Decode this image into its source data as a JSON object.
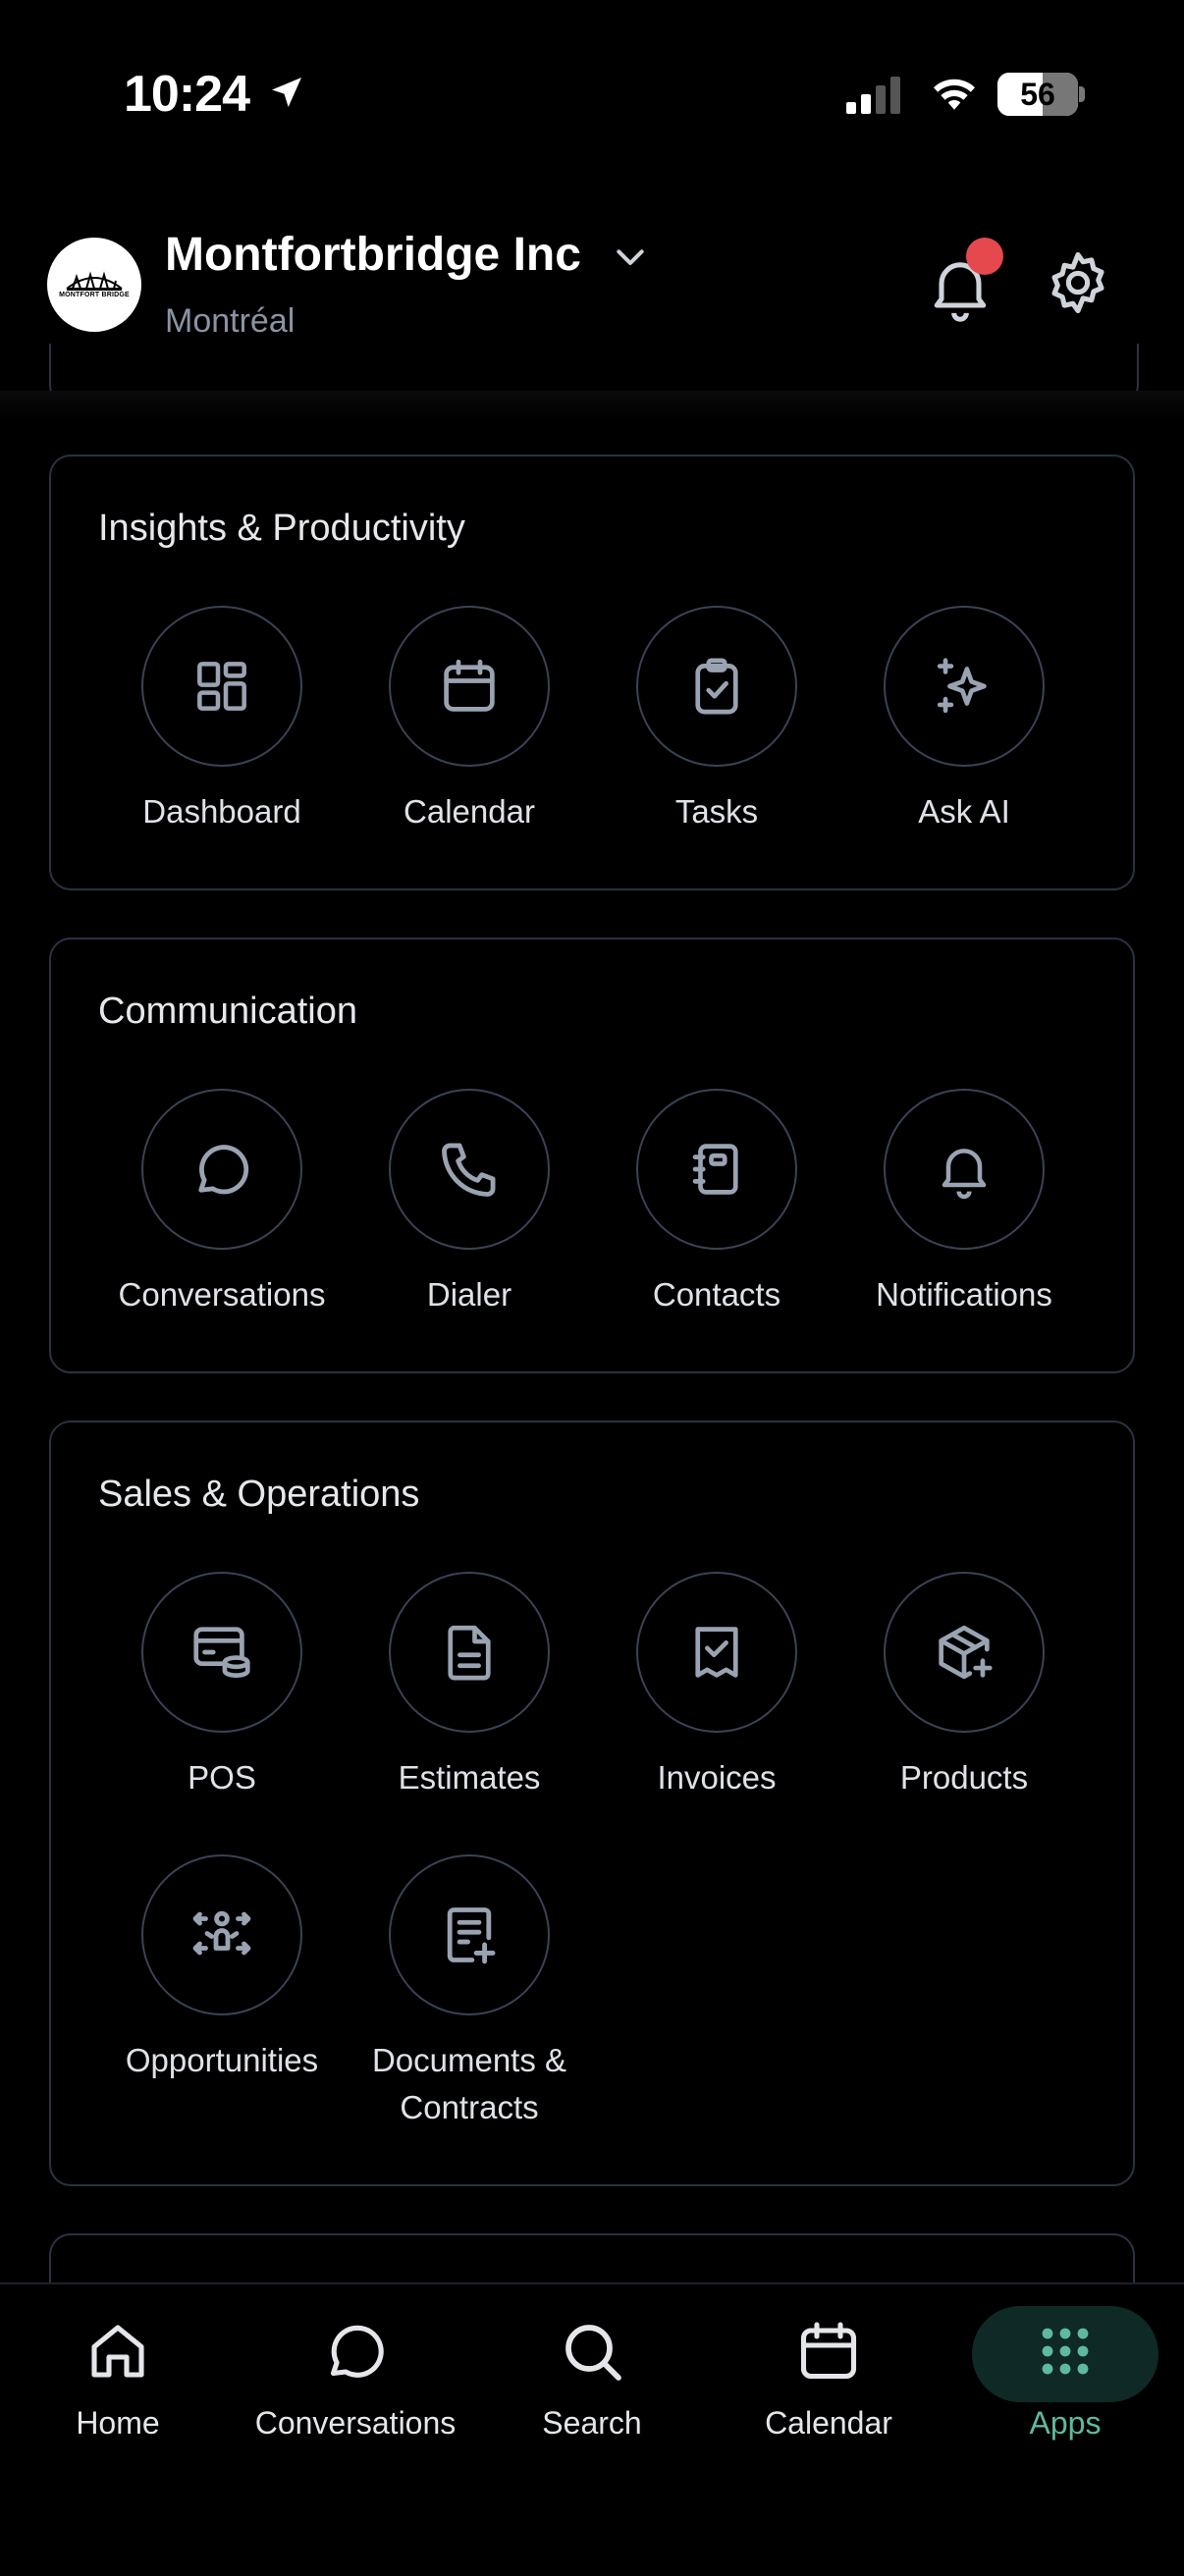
{
  "status_bar": {
    "time": "10:24",
    "battery": "56"
  },
  "header": {
    "logo_text": "MONTFORT BRIDGE",
    "company": "Montfortbridge Inc",
    "city": "Montréal"
  },
  "sections": [
    {
      "title": "Insights & Productivity",
      "apps": [
        {
          "label": "Dashboard",
          "icon": "dashboard-icon"
        },
        {
          "label": "Calendar",
          "icon": "calendar-icon"
        },
        {
          "label": "Tasks",
          "icon": "tasks-icon"
        },
        {
          "label": "Ask AI",
          "icon": "sparkle-icon"
        }
      ]
    },
    {
      "title": "Communication",
      "apps": [
        {
          "label": "Conversations",
          "icon": "chat-icon"
        },
        {
          "label": "Dialer",
          "icon": "phone-icon"
        },
        {
          "label": "Contacts",
          "icon": "contacts-icon"
        },
        {
          "label": "Notifications",
          "icon": "bell-icon"
        }
      ]
    },
    {
      "title": "Sales & Operations",
      "apps": [
        {
          "label": "POS",
          "icon": "pos-icon"
        },
        {
          "label": "Estimates",
          "icon": "document-icon"
        },
        {
          "label": "Invoices",
          "icon": "receipt-icon"
        },
        {
          "label": "Products",
          "icon": "box-plus-icon"
        },
        {
          "label": "Opportunities",
          "icon": "opportunities-icon"
        },
        {
          "label": "Documents & Contracts",
          "icon": "document-plus-icon"
        }
      ]
    }
  ],
  "nav": [
    {
      "label": "Home",
      "icon": "home-icon"
    },
    {
      "label": "Conversations",
      "icon": "chat-icon"
    },
    {
      "label": "Search",
      "icon": "search-icon"
    },
    {
      "label": "Calendar",
      "icon": "calendar-icon"
    },
    {
      "label": "Apps",
      "icon": "grid-icon",
      "active": true
    }
  ],
  "colors": {
    "accent": "#5fb8a0",
    "border": "#2b3240",
    "notification_dot": "#e5484d"
  }
}
